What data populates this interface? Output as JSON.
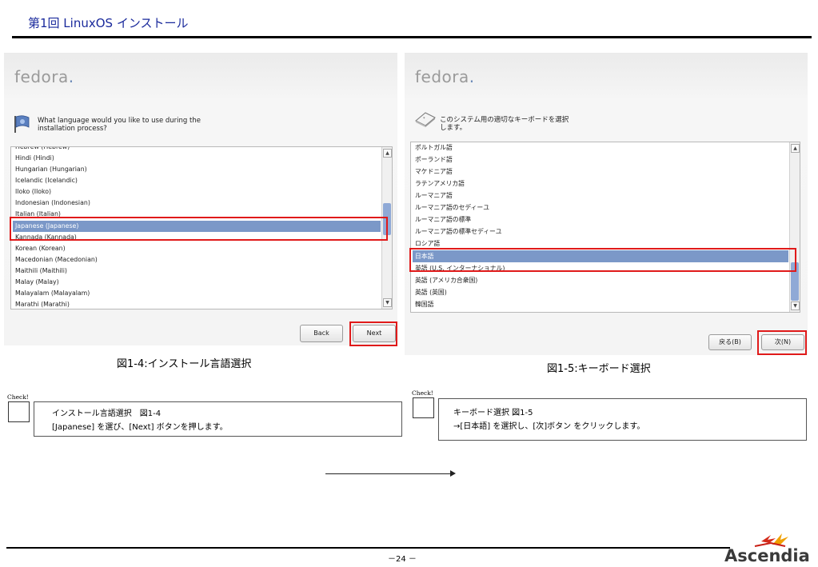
{
  "document": {
    "title": "第1回 LinuxOS インストール",
    "page_number": "－24 －",
    "brand": "Ascendia"
  },
  "figure_left": {
    "logo_text": "fedora",
    "prompt_line1": "What language would you like to use during the",
    "prompt_line2": "installation process?",
    "items": [
      "Hebrew (Hebrew)",
      "Hindi (Hindi)",
      "Hungarian (Hungarian)",
      "Icelandic (Icelandic)",
      "Iloko (Iloko)",
      "Indonesian (Indonesian)",
      "Italian (Italian)",
      "Japanese (Japanese)",
      "Kannada (Kannada)",
      "Korean (Korean)",
      "Macedonian (Macedonian)",
      "Maithili (Maithili)",
      "Malay (Malay)",
      "Malayalam (Malayalam)",
      "Marathi (Marathi)"
    ],
    "selected_item": "Japanese (Japanese)",
    "back_label": "Back",
    "next_label": "Next",
    "caption": "図1-4:インストール言語選択"
  },
  "figure_right": {
    "logo_text": "fedora",
    "prompt_line1": "このシステム用の適切なキーボードを選択",
    "prompt_line2": "します。",
    "items": [
      "ポルトガル語",
      "ポーランド語",
      "マケドニア語",
      "ラテンアメリカ語",
      "ルーマニア語",
      "ルーマニア語のセディーユ",
      "ルーマニア語の標準",
      "ルーマニア語の標準セディーユ",
      "ロシア語",
      "日本語",
      "英語 (U.S. インターナショナル)",
      "英語 (アメリカ合衆国)",
      "英語 (英国)",
      "韓国語"
    ],
    "selected_item": "日本語",
    "back_label": "戻る(B)",
    "next_label": "次(N)",
    "caption": "図1-5:キーボード選択"
  },
  "check_left": {
    "label": "Check!",
    "line1": "インストール言語選択　図1-4",
    "line2": "[Japanese] を選び、[Next] ボタンを押します。"
  },
  "check_right": {
    "label": "Check!",
    "line1": "キーボード選択 図1-5",
    "line2": "→[日本語] を選択し、[次]ボタン をクリックします。"
  },
  "colors": {
    "title": "#1a2a9c",
    "highlight": "#e01a1a",
    "selection": "#7b98c8",
    "brand_red": "#d42a1a",
    "brand_orange": "#f0a000"
  },
  "icons": {
    "left_prompt": "flag-icon",
    "right_prompt": "keyboard-icon",
    "brand": "ascendia-bird-logo"
  }
}
